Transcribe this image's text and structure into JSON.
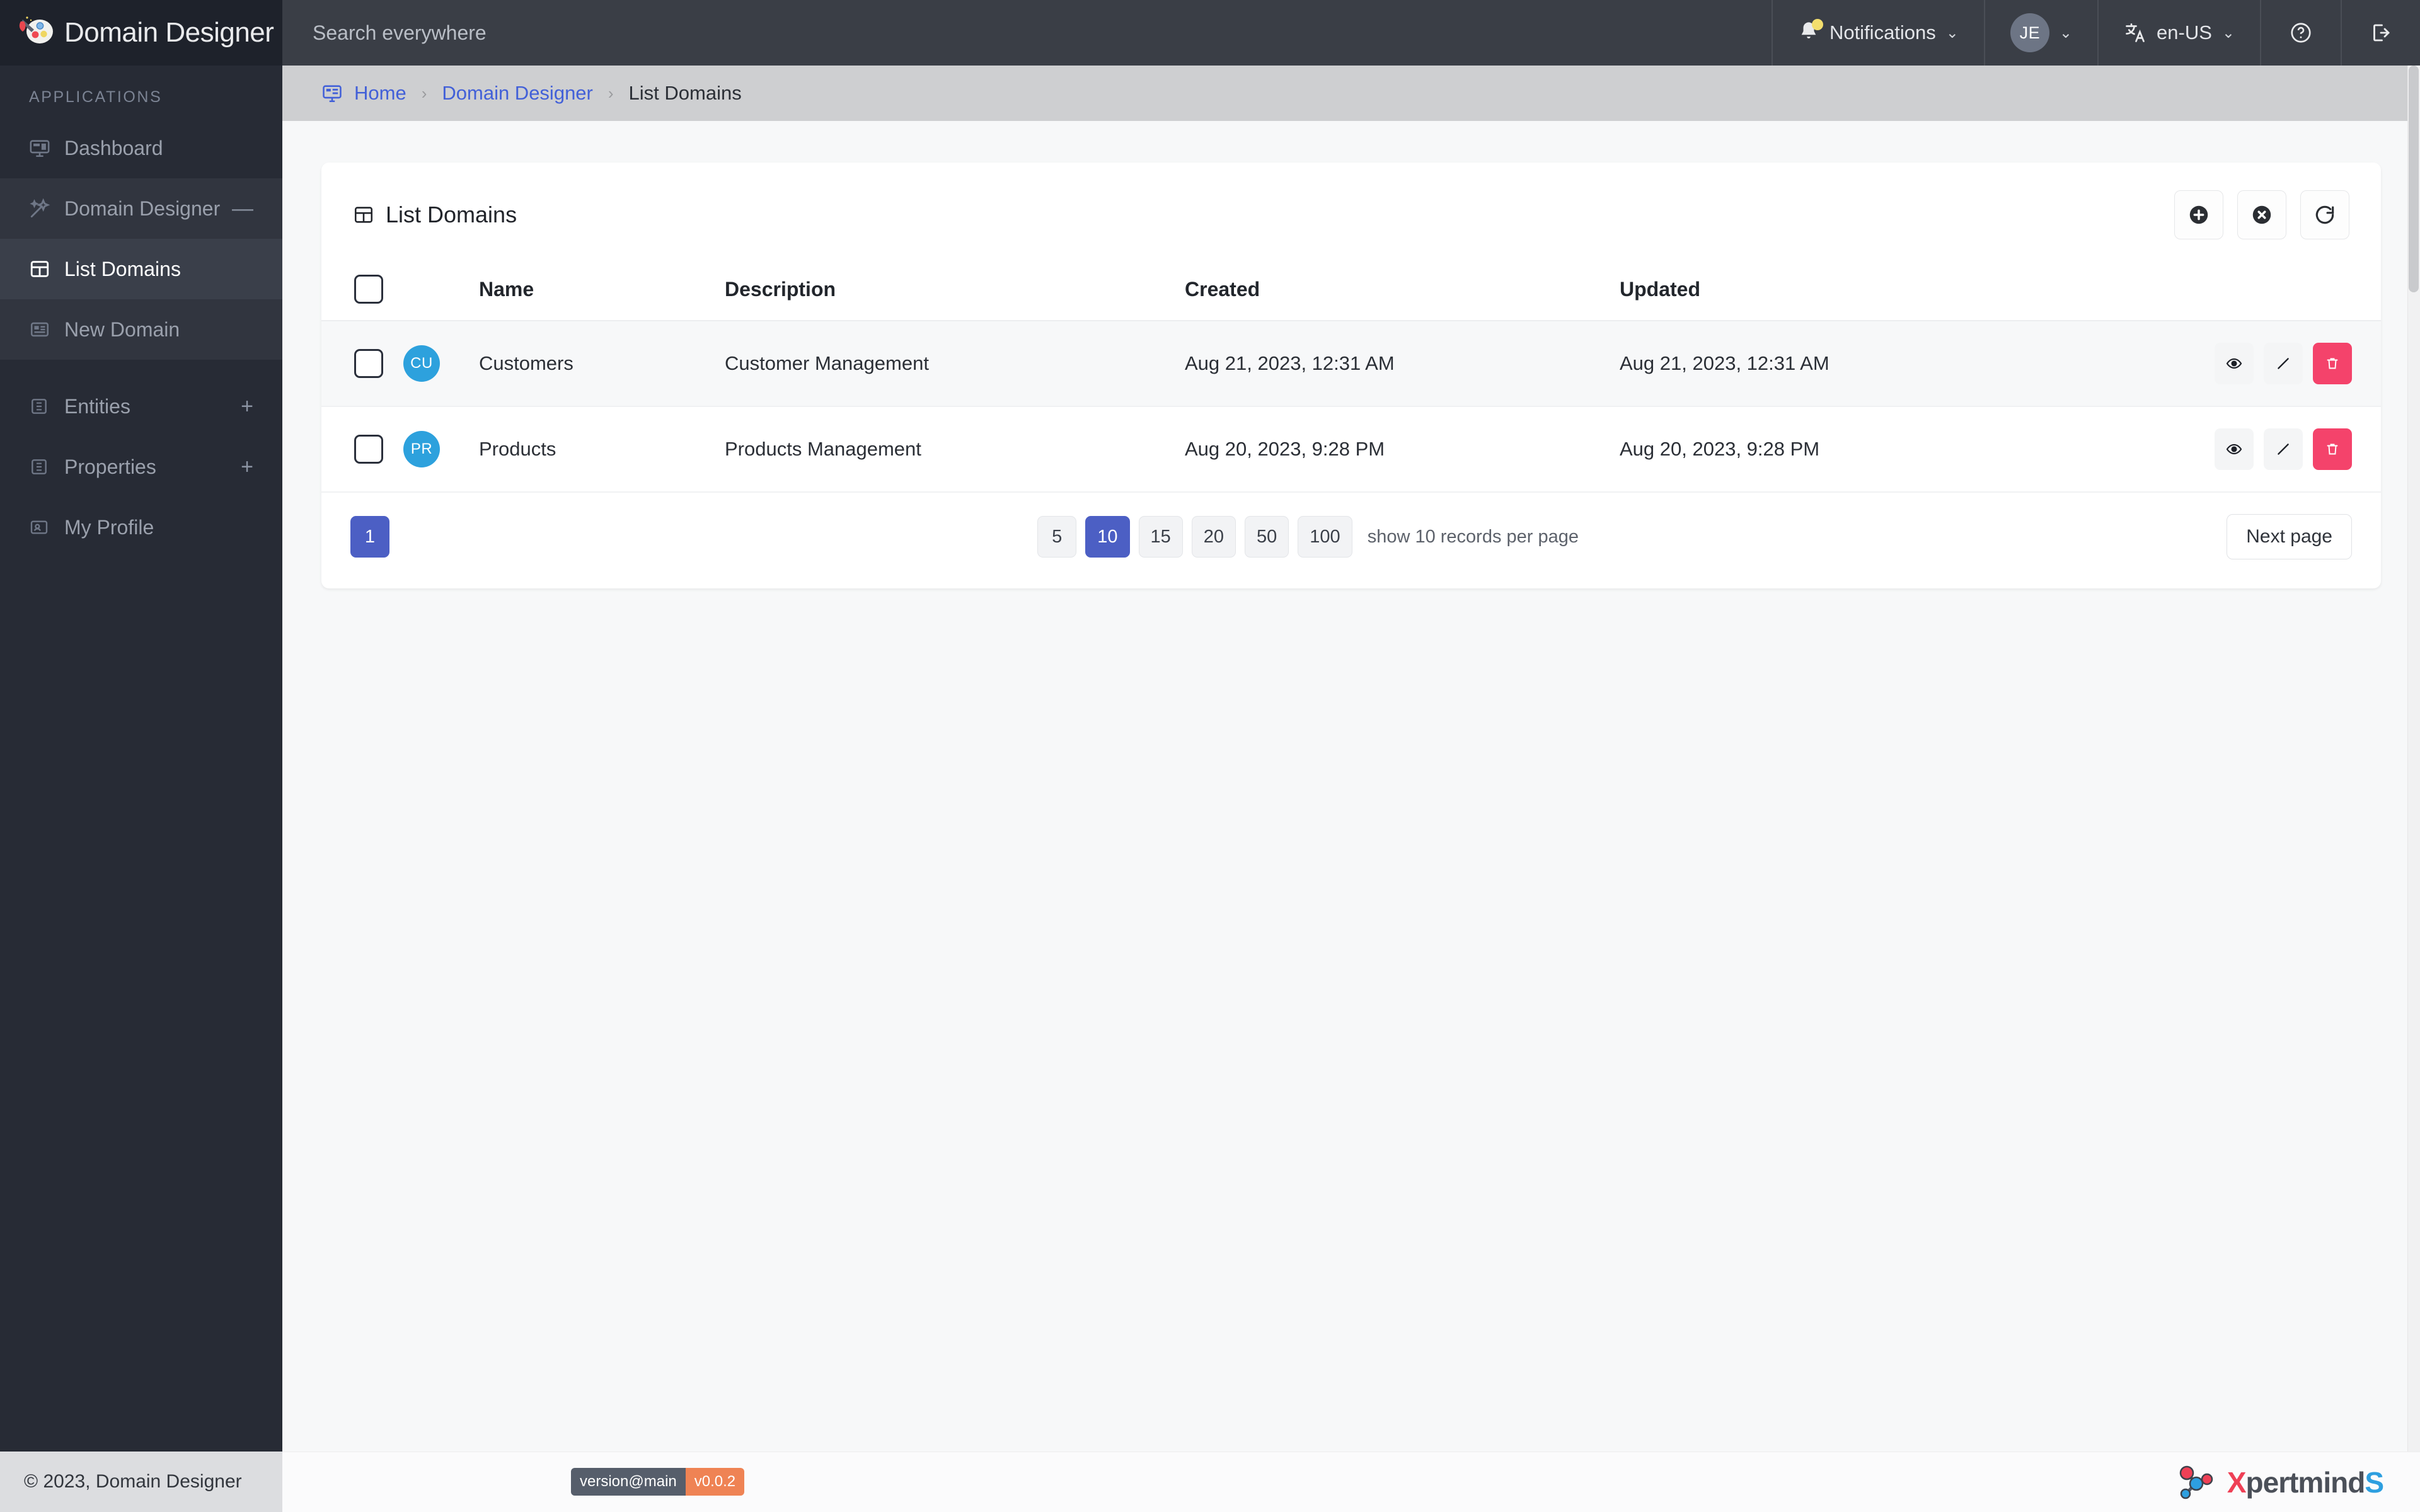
{
  "brand": {
    "title": "Domain Designer",
    "logo_icon": "paint-palette-icon"
  },
  "topbar": {
    "search": {
      "placeholder": "Search everywhere",
      "value": ""
    },
    "notifications": {
      "label": "Notifications",
      "icon": "bell-icon",
      "has_badge": true,
      "caret": "⌄"
    },
    "user": {
      "initials": "JE",
      "caret": "⌄"
    },
    "language": {
      "icon": "translate-icon",
      "label": "en-US",
      "caret": "⌄"
    },
    "help": {
      "icon": "help-circle-icon"
    },
    "logout": {
      "icon": "logout-icon"
    }
  },
  "sidebar": {
    "section_label": "APPLICATIONS",
    "items": [
      {
        "label": "Dashboard",
        "icon": "dashboard-icon",
        "affix": "",
        "active": false
      },
      {
        "label": "Domain Designer",
        "icon": "magic-wand-icon",
        "affix": "—",
        "active": false
      },
      {
        "label": "List Domains",
        "icon": "table-icon",
        "affix": "",
        "active": true
      },
      {
        "label": "New Domain",
        "icon": "form-list-icon",
        "affix": "",
        "active": false
      },
      {
        "label": "Entities",
        "icon": "entity-icon",
        "affix": "+",
        "active": false
      },
      {
        "label": "Properties",
        "icon": "entity-icon",
        "affix": "+",
        "active": false
      },
      {
        "label": "My Profile",
        "icon": "profile-card-icon",
        "affix": "",
        "active": false
      }
    ]
  },
  "breadcrumb": {
    "icon": "home-monitor-icon",
    "items": [
      {
        "label": "Home",
        "link": true
      },
      {
        "label": "Domain Designer",
        "link": true
      },
      {
        "label": "List Domains",
        "link": false
      }
    ],
    "separator": "›"
  },
  "card": {
    "title": "List Domains",
    "title_icon": "table-icon",
    "actions": [
      {
        "name": "add",
        "icon": "plus-circle-icon"
      },
      {
        "name": "delete",
        "icon": "x-circle-icon"
      },
      {
        "name": "refresh",
        "icon": "refresh-icon"
      }
    ],
    "table": {
      "columns": [
        "",
        "",
        "Name",
        "Description",
        "Created",
        "Updated",
        ""
      ],
      "rows": [
        {
          "selected": false,
          "initials": "CU",
          "avatar_color": "#2da1dd",
          "name": "Customers",
          "description": "Customer Management",
          "created": "Aug 21, 2023, 12:31 AM",
          "updated": "Aug 21, 2023, 12:31 AM",
          "actions": [
            "view-icon",
            "edit-icon",
            "delete-icon"
          ]
        },
        {
          "selected": false,
          "initials": "PR",
          "avatar_color": "#2da1dd",
          "name": "Products",
          "description": "Products Management",
          "created": "Aug 20, 2023, 9:28 PM",
          "updated": "Aug 20, 2023, 9:28 PM",
          "actions": [
            "view-icon",
            "edit-icon",
            "delete-icon"
          ]
        }
      ]
    },
    "pagination": {
      "current_page": "1",
      "page_sizes": [
        "5",
        "10",
        "15",
        "20",
        "50",
        "100"
      ],
      "active_page_size": "10",
      "records_note": "show 10 records per page",
      "next_label": "Next page"
    }
  },
  "footer": {
    "copyright": "© 2023, Domain Designer",
    "version_label": "version@main",
    "version_value": "v0.0.2",
    "vendor": {
      "prefix": "X",
      "middle": "pertmind",
      "suffix": "S",
      "icon": "molecule-icon"
    }
  },
  "colors": {
    "accent_blue": "#4c5fc4",
    "link_blue": "#4260d8",
    "danger": "#f4436b",
    "avatar_blue": "#2da1dd",
    "sidebar_bg": "#272b35",
    "topbar_bg": "#3a3e46",
    "breadcrumb_bg": "#cecfd1",
    "version_orange": "#ef8354"
  }
}
